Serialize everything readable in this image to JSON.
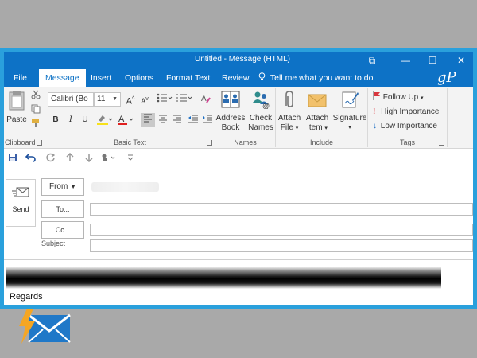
{
  "window": {
    "title": "Untitled  -  Message (HTML)",
    "controls": {
      "ribbon_display": "⧉",
      "minimize": "—",
      "maximize": "☐",
      "close": "✕"
    }
  },
  "tabs": [
    {
      "label": "File"
    },
    {
      "label": "Message",
      "active": true
    },
    {
      "label": "Insert"
    },
    {
      "label": "Options"
    },
    {
      "label": "Format Text"
    },
    {
      "label": "Review"
    }
  ],
  "tell_me": "Tell me what you want to do",
  "brand_logo": "gP",
  "ribbon": {
    "clipboard": {
      "label": "Clipboard",
      "paste": "Paste"
    },
    "basic_text": {
      "label": "Basic Text",
      "font_name": "Calibri (Bo",
      "font_size": "11",
      "grow": "A",
      "shrink": "A",
      "bold": "B",
      "italic": "I",
      "underline": "U"
    },
    "names": {
      "label": "Names",
      "address_book": [
        "Address",
        "Book"
      ],
      "check_names": [
        "Check",
        "Names"
      ]
    },
    "include": {
      "label": "Include",
      "attach_file": [
        "Attach",
        "File"
      ],
      "attach_item": [
        "Attach",
        "Item"
      ],
      "signature": "Signature"
    },
    "tags": {
      "label": "Tags",
      "follow_up": "Follow Up",
      "high_importance": "High Importance",
      "low_importance": "Low Importance"
    }
  },
  "compose": {
    "send": "Send",
    "from": "From",
    "to": "To...",
    "cc": "Cc...",
    "subject": "Subject",
    "body_text": "Regards"
  },
  "colors": {
    "frame": "#2aa0dc",
    "titlebar": "#0d72c6",
    "ribbon_bg": "#f3f3f3",
    "flag": "#d9363e",
    "importance_high": "#d9363e",
    "importance_low": "#1c6fc4",
    "highlight": "#f7e11b",
    "font_color": "#e02020"
  }
}
